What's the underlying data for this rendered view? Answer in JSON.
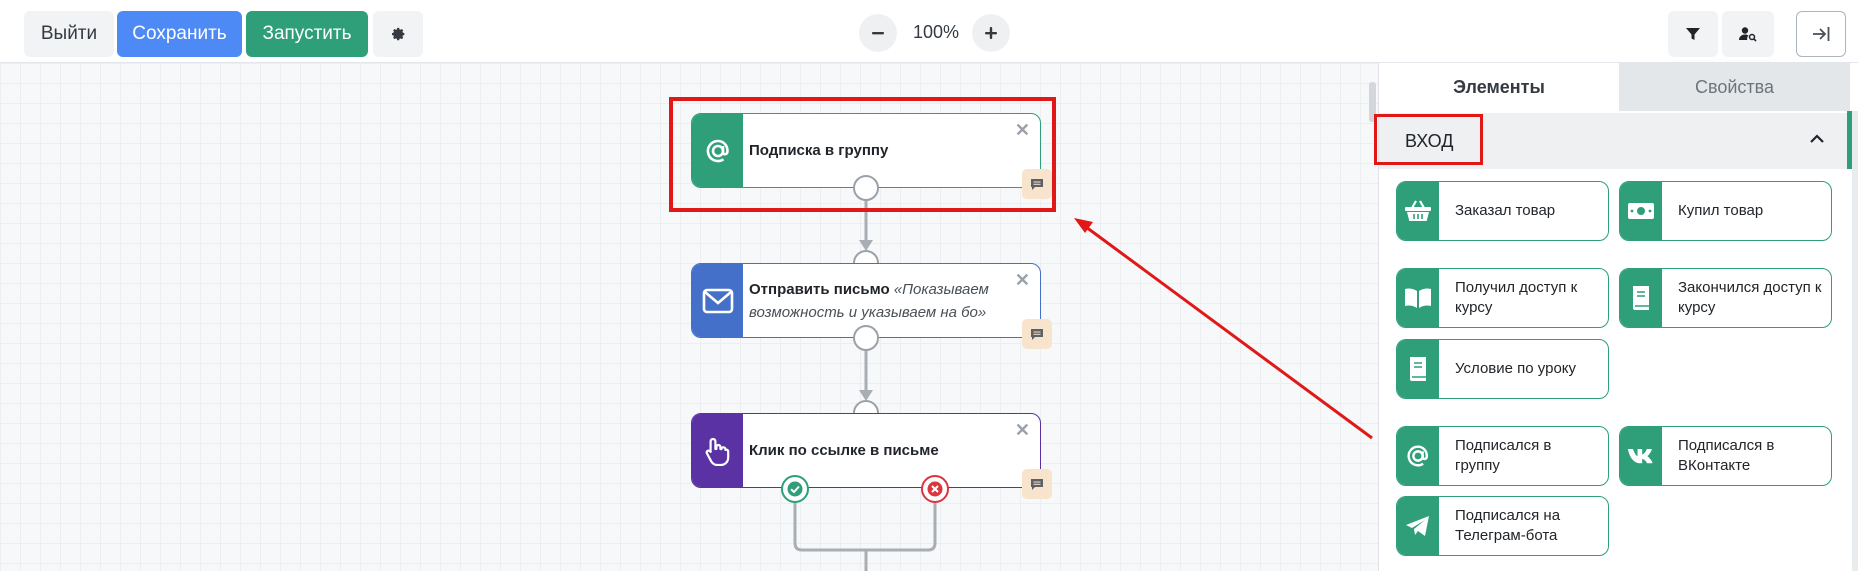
{
  "toolbar": {
    "exit_label": "Выйти",
    "save_label": "Сохранить",
    "run_label": "Запустить",
    "zoom_value": "100%"
  },
  "canvas": {
    "nodes": [
      {
        "title": "Подписка в группу",
        "subtitle": "",
        "icon": "at-icon",
        "color": "#2e9f79"
      },
      {
        "title": "Отправить письмо",
        "subtitle": "«Показываем возможность и указываем на бо»",
        "icon": "envelope-icon",
        "color": "#4470c9"
      },
      {
        "title": "Клик по ссылке в письме",
        "subtitle": "",
        "icon": "pointer-hand-icon",
        "color": "#5a32a3"
      }
    ]
  },
  "panel": {
    "tabs": {
      "elements": "Элементы",
      "properties": "Свойства"
    },
    "section_title": "ВХОД",
    "cards": [
      {
        "label": "Заказал товар",
        "icon": "basket-icon"
      },
      {
        "label": "Купил товар",
        "icon": "banknote-icon"
      },
      {
        "label": "Получил доступ к курсу",
        "icon": "open-book-icon"
      },
      {
        "label": "Закончился доступ к курсу",
        "icon": "closed-book-icon"
      },
      {
        "label": "Условие по уроку",
        "icon": "lesson-book-icon"
      },
      {
        "label": "Подписался в группу",
        "icon": "at-icon"
      },
      {
        "label": "Подписался в ВКонтакте",
        "icon": "vk-icon"
      },
      {
        "label": "Подписался на Телеграм-бота",
        "icon": "telegram-icon"
      }
    ]
  },
  "colors": {
    "accent_green": "#2e9f79",
    "save_blue": "#4e8af5",
    "annotation_red": "#e01818"
  }
}
